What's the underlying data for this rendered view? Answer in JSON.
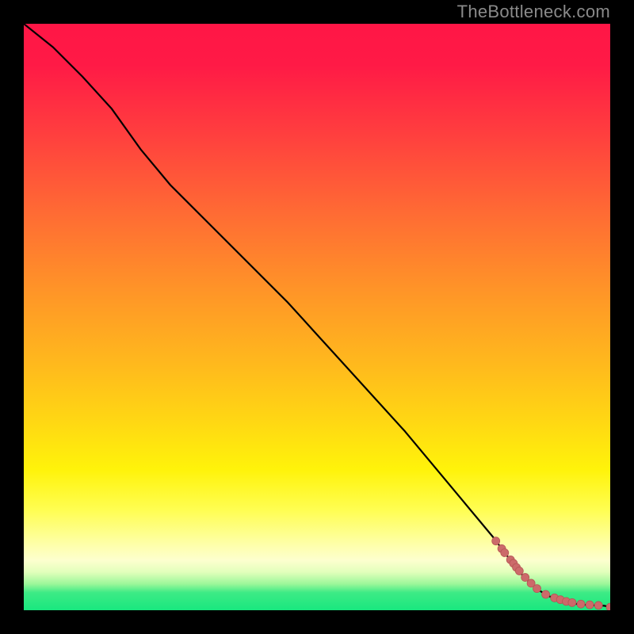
{
  "attribution": "TheBottleneck.com",
  "colors": {
    "line": "#000000",
    "markerFill": "#cc6a6a",
    "markerStroke": "#b65555"
  },
  "chart_data": {
    "type": "line",
    "title": "",
    "xlabel": "",
    "ylabel": "",
    "xlim": [
      0,
      100
    ],
    "ylim": [
      0,
      100
    ],
    "series": [
      {
        "name": "bottleneck-curve",
        "x": [
          0,
          5,
          10,
          15,
          20,
          25,
          30,
          35,
          40,
          45,
          50,
          55,
          60,
          65,
          70,
          75,
          80,
          83,
          85,
          87,
          88,
          89,
          90,
          91,
          92,
          93,
          94,
          95,
          96,
          97,
          98,
          99,
          100
        ],
        "y": [
          100,
          96,
          91,
          85.5,
          78.5,
          72.5,
          67.5,
          62.5,
          57.5,
          52.5,
          47,
          41.5,
          36,
          30.5,
          24.5,
          18.5,
          12.5,
          8.5,
          6,
          4,
          3.3,
          2.7,
          2.2,
          1.8,
          1.5,
          1.3,
          1.1,
          1.0,
          0.9,
          0.85,
          0.8,
          0.76,
          0.52
        ]
      }
    ],
    "markers": {
      "name": "highlighted-points",
      "x": [
        80.5,
        81.5,
        82,
        83,
        83.5,
        84,
        84.5,
        85.5,
        86.5,
        87.5,
        89,
        90.5,
        91.5,
        92.5,
        93.5,
        95,
        96.5,
        98,
        100
      ],
      "y": [
        11.8,
        10.5,
        9.8,
        8.6,
        8.0,
        7.3,
        6.7,
        5.6,
        4.6,
        3.7,
        2.7,
        2.1,
        1.8,
        1.5,
        1.3,
        1.05,
        0.92,
        0.82,
        0.52
      ]
    }
  }
}
